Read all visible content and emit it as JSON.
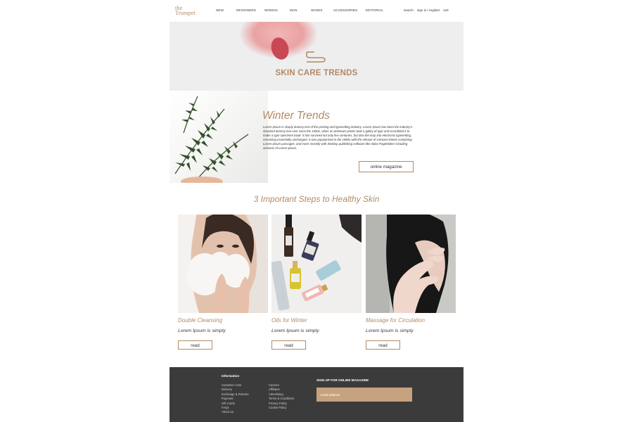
{
  "header": {
    "logo_line1": "the",
    "logo_line2": "Trumpet",
    "nav": [
      "NEW",
      "DESIGNERS",
      "WOMAN",
      "MAN",
      "SHOES",
      "ACCESSORIES",
      "EDITORIAL"
    ],
    "search": "search",
    "signin": "sign in / register",
    "cart": "cart"
  },
  "hero": {
    "title": "SKIN CARE TRENDS"
  },
  "winter": {
    "title": "Winter Trends",
    "body": "Lorem Ipsum is simply dummy text of the printing and typesetting industry. Lorem Ipsum has been the industry's standard dummy text ever since the 1500s, when an unknown printer took a galley of type and scrambled it to make a type specimen book. It has survived not only five centuries, but also the leap into electronic typesetting, remaining essentially unchanged. It was popularised in the 1960s with the release of Letraset sheets containing Lorem Ipsum passages, and more recently with desktop publishing software like Aldus PageMaker including versions of Lorem Ipsum.",
    "button": "online magazine"
  },
  "steps": {
    "title": "3 Important Steps to Healthy Skin",
    "cards": [
      {
        "title": "Double Cleansing",
        "text": "Lorem Ipsum is simply",
        "button": "read"
      },
      {
        "title": "Oils for Winter",
        "text": "Lorem Ipsum is simply",
        "button": "read"
      },
      {
        "title": "Massage for Circulation",
        "text": "Lorem Ipsum is simply",
        "button": "read"
      }
    ]
  },
  "footer": {
    "heading": "Information",
    "col1": [
      "Customer Care",
      "Delivery",
      "Exchange & Returns",
      "Payment",
      "Gift Cards",
      "FAQs",
      "About Us"
    ],
    "col2": [
      "Careers",
      "Affiliates",
      "Advertising",
      "Terms & Conditions",
      "Privacy Policy",
      "Cookie Policy"
    ],
    "signup_title": "SIGN UP FOR ONLINE MAGAZINE",
    "email_placeholder": "email address"
  },
  "colors": {
    "accent": "#b48a63",
    "footer_bg": "#3b3b3b",
    "input_bg": "#c7a27f"
  }
}
